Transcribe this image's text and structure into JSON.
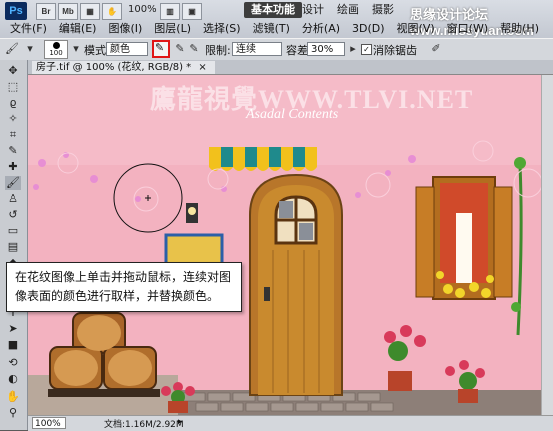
{
  "app": {
    "logo": "Ps",
    "bridge_icon": "Br",
    "minibridge_icon": "Mb",
    "zoom": "100%",
    "workspaces": [
      "基本功能",
      "设计",
      "绘画",
      "摄影"
    ],
    "watermark": "思缘设计论坛 www.missyuan.com"
  },
  "menus": [
    "文件(F)",
    "编辑(E)",
    "图像(I)",
    "图层(L)",
    "选择(S)",
    "滤镜(T)",
    "分析(A)",
    "3D(D)",
    "视图(V)",
    "窗口(W)",
    "帮助(H)"
  ],
  "options": {
    "brush_size": "100",
    "mode_label": "模式:",
    "mode_value": "颜色",
    "limit_label": "限制:",
    "limit_value": "连续",
    "tolerance_label": "容差:",
    "tolerance_value": "30%",
    "antialias_label": "消除锯齿"
  },
  "document": {
    "tab_title": "房子.tif @ 100% (花纹, RGB/8) *",
    "close": "×"
  },
  "canvas": {
    "watermark": "鷹龍視覺WWW.TLVI.NET",
    "script_text": "Asadal Contents"
  },
  "callout": {
    "text": "在花纹图像上单击并拖动鼠标，连续对图像表面的颜色进行取样，并替换颜色。"
  },
  "status": {
    "zoom": "100%",
    "doc_info": "文档:1.16M/2.92M"
  },
  "colors": {
    "canvas_bg": "#f3b2c0",
    "highlight": "#e01515",
    "awning_teal": "#1f8a8c",
    "awning_yellow": "#f2c11c",
    "door_wood": "#c98a2e"
  }
}
